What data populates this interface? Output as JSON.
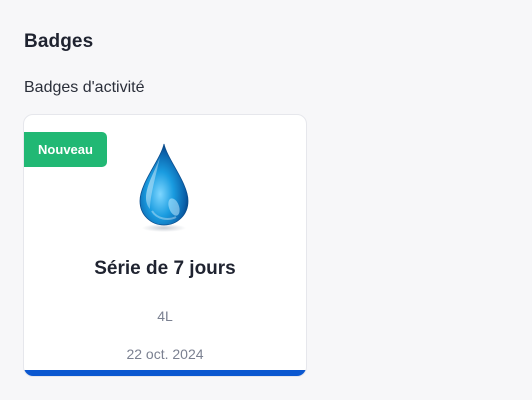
{
  "header": {
    "title": "Badges"
  },
  "section": {
    "title": "Badges d'activité"
  },
  "badges": [
    {
      "tag": "Nouveau",
      "icon": "water-drop-icon",
      "name": "Série de 7 jours",
      "value": "4L",
      "date": "22 oct. 2024",
      "colors": {
        "tag": "#21b874",
        "bar": "#0c58d0",
        "drop": "#1a9ce0"
      }
    }
  ]
}
